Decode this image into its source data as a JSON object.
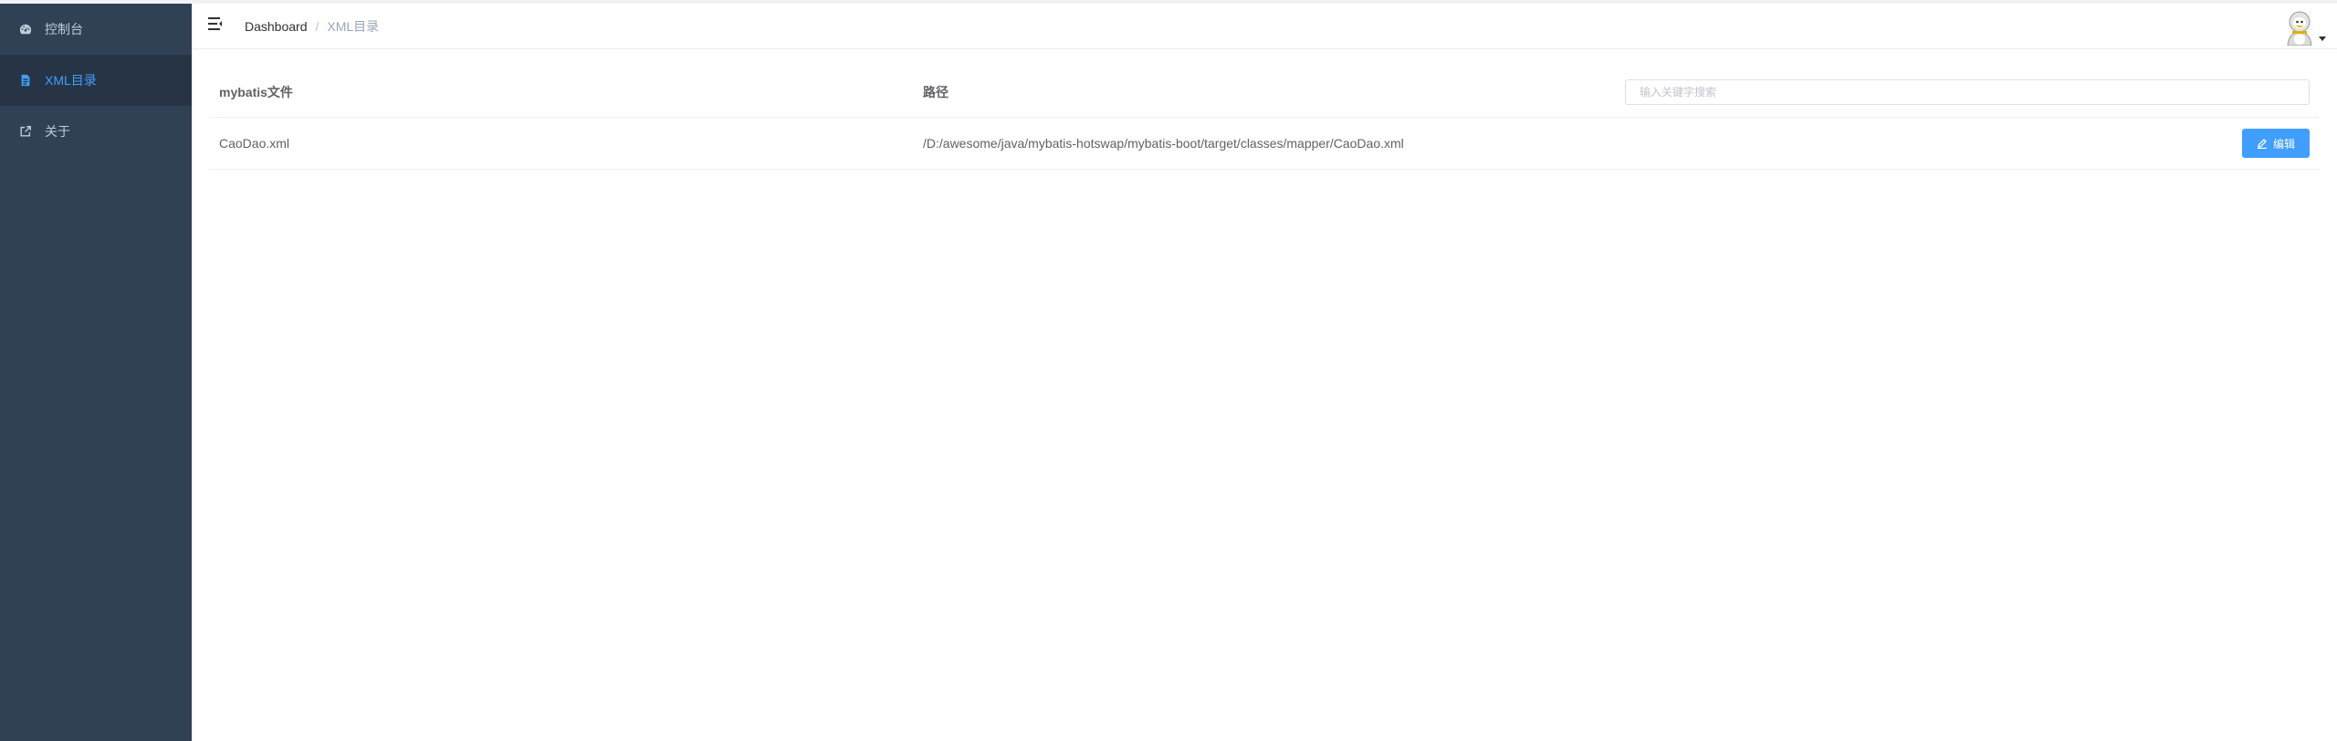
{
  "sidebar": {
    "items": [
      {
        "label": "控制台",
        "icon": "dashboard-icon",
        "active": false
      },
      {
        "label": "XML目录",
        "icon": "document-icon",
        "active": true
      },
      {
        "label": "关于",
        "icon": "external-link-icon",
        "active": false
      }
    ]
  },
  "navbar": {
    "hamburger_icon": "hamburger-icon",
    "breadcrumb": [
      {
        "label": "Dashboard"
      },
      {
        "label": "XML目录"
      }
    ],
    "avatar_icon": "avatar-icon"
  },
  "table": {
    "headers": {
      "file": "mybatis文件",
      "path": "路径"
    },
    "search": {
      "placeholder": "输入关键字搜索",
      "value": ""
    },
    "rows": [
      {
        "file": "CaoDao.xml",
        "path": "/D:/awesome/java/mybatis-hotswap/mybatis-boot/target/classes/mapper/CaoDao.xml",
        "action_label": "编辑",
        "action_icon": "edit-icon"
      }
    ]
  },
  "colors": {
    "sidebar_bg": "#304156",
    "sidebar_active_bg": "#263445",
    "accent": "#409eff",
    "sidebar_text": "#bfcbd9"
  }
}
